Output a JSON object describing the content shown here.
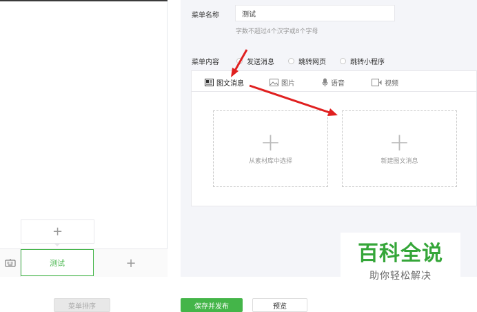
{
  "editor": {
    "name_label": "菜单名称",
    "name_value": "测试",
    "name_hint": "字数不超过4个汉字或8个字母",
    "content_label": "菜单内容",
    "radio_options": [
      "发送消息",
      "跳转网页",
      "跳转小程序"
    ],
    "tabs": [
      "图文消息",
      "图片",
      "语音",
      "视频"
    ],
    "cards": [
      "从素材库中选择",
      "新建图文消息"
    ]
  },
  "preview": {
    "menu_item": "测试",
    "add_symbol": "+"
  },
  "footer": {
    "sort_label": "菜单排序",
    "save_label": "保存并发布",
    "preview_label": "预览"
  },
  "watermark": {
    "title": "百科全说",
    "subtitle": "助你轻松解决"
  },
  "colors": {
    "accent": "#44b549",
    "annotation": "#e02020",
    "editor_bg": "#f4f5f9"
  },
  "icons": [
    "keyboard-icon",
    "plus-icon",
    "article-icon",
    "image-icon",
    "microphone-icon",
    "video-icon"
  ]
}
